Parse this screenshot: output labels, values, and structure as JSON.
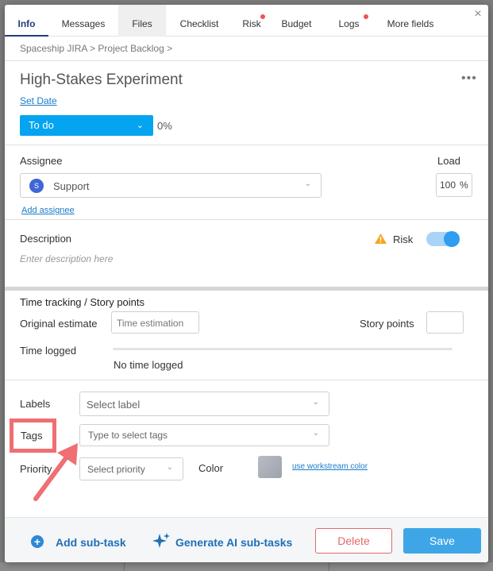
{
  "tabs": [
    {
      "label": "Info"
    },
    {
      "label": "Messages"
    },
    {
      "label": "Files"
    },
    {
      "label": "Checklist"
    },
    {
      "label": "Risk"
    },
    {
      "label": "Budget"
    },
    {
      "label": "Logs"
    },
    {
      "label": "More fields"
    }
  ],
  "breadcrumb": "Spaceship JIRA > Project Backlog >",
  "task": {
    "title": "High-Stakes Experiment",
    "set_date": "Set Date",
    "status": "To do",
    "progress": "0%"
  },
  "assignee": {
    "label": "Assignee",
    "load_label": "Load",
    "avatar_letter": "S",
    "name": "Support",
    "load_value": "100",
    "load_unit": "%",
    "add_link": "Add assignee"
  },
  "description": {
    "label": "Description",
    "placeholder": "Enter description here",
    "risk_label": "Risk",
    "risk_enabled": true
  },
  "time": {
    "section_title": "Time tracking / Story points",
    "original_estimate_label": "Original estimate",
    "estimate_placeholder": "Time estimation",
    "story_points_label": "Story points",
    "time_logged_label": "Time logged",
    "no_time_logged": "No time logged"
  },
  "fields": {
    "labels_label": "Labels",
    "labels_placeholder": "Select label",
    "tags_label": "Tags",
    "tags_placeholder": "Type to select tags",
    "priority_label": "Priority",
    "priority_placeholder": "Select priority",
    "color_label": "Color",
    "workstream_link": "use workstream color"
  },
  "footer": {
    "add_subtask": "Add sub-task",
    "generate_ai": "Generate AI sub-tasks",
    "delete": "Delete",
    "save": "Save"
  },
  "colors": {
    "accent": "#05a4f0",
    "highlight": "#ef6f73",
    "save": "#3ea6e6",
    "delete": "#e06a6a"
  }
}
